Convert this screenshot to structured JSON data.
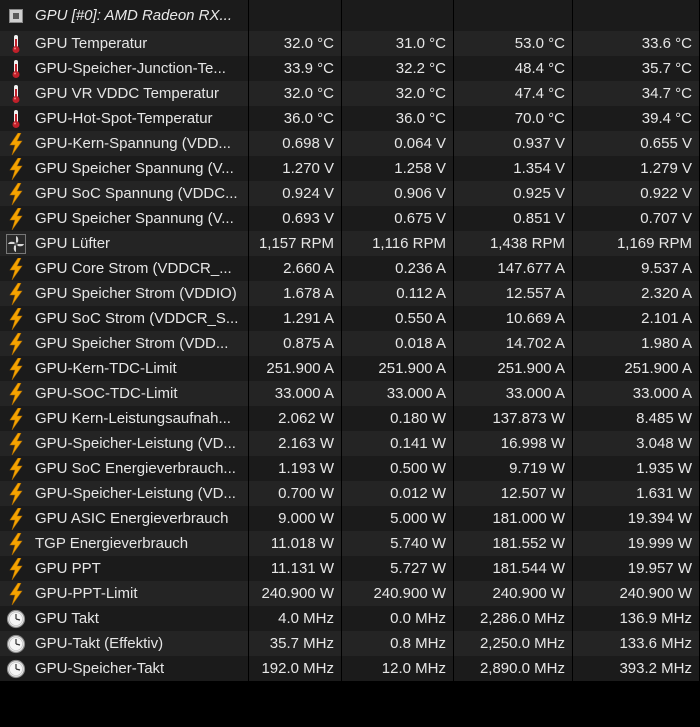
{
  "device": {
    "title": "GPU [#0]: AMD Radeon RX...",
    "icon": "chip-icon"
  },
  "rows": [
    {
      "label": "GPU Temperatur",
      "icon": "thermometer-icon",
      "v": [
        "32.0 °C",
        "31.0 °C",
        "53.0 °C",
        "33.6 °C"
      ]
    },
    {
      "label": "GPU-Speicher-Junction-Te...",
      "icon": "thermometer-icon",
      "v": [
        "33.9 °C",
        "32.2 °C",
        "48.4 °C",
        "35.7 °C"
      ]
    },
    {
      "label": "GPU VR VDDC Temperatur",
      "icon": "thermometer-icon",
      "v": [
        "32.0 °C",
        "32.0 °C",
        "47.4 °C",
        "34.7 °C"
      ]
    },
    {
      "label": "GPU-Hot-Spot-Temperatur",
      "icon": "thermometer-icon",
      "v": [
        "36.0 °C",
        "36.0 °C",
        "70.0 °C",
        "39.4 °C"
      ]
    },
    {
      "label": "GPU-Kern-Spannung (VDD...",
      "icon": "lightning-icon",
      "v": [
        "0.698 V",
        "0.064 V",
        "0.937 V",
        "0.655 V"
      ]
    },
    {
      "label": "GPU Speicher Spannung (V...",
      "icon": "lightning-icon",
      "v": [
        "1.270 V",
        "1.258 V",
        "1.354 V",
        "1.279 V"
      ]
    },
    {
      "label": "GPU SoC Spannung (VDDC...",
      "icon": "lightning-icon",
      "v": [
        "0.924 V",
        "0.906 V",
        "0.925 V",
        "0.922 V"
      ]
    },
    {
      "label": "GPU Speicher Spannung (V...",
      "icon": "lightning-icon",
      "v": [
        "0.693 V",
        "0.675 V",
        "0.851 V",
        "0.707 V"
      ]
    },
    {
      "label": "GPU Lüfter",
      "icon": "fan-icon",
      "v": [
        "1,157 RPM",
        "1,116 RPM",
        "1,438 RPM",
        "1,169 RPM"
      ]
    },
    {
      "label": "GPU Core Strom (VDDCR_...",
      "icon": "lightning-icon",
      "v": [
        "2.660 A",
        "0.236 A",
        "147.677 A",
        "9.537 A"
      ]
    },
    {
      "label": "GPU Speicher Strom (VDDIO)",
      "icon": "lightning-icon",
      "v": [
        "1.678 A",
        "0.112 A",
        "12.557 A",
        "2.320 A"
      ]
    },
    {
      "label": "GPU SoC Strom (VDDCR_S...",
      "icon": "lightning-icon",
      "v": [
        "1.291 A",
        "0.550 A",
        "10.669 A",
        "2.101 A"
      ]
    },
    {
      "label": "GPU Speicher Strom (VDD...",
      "icon": "lightning-icon",
      "v": [
        "0.875 A",
        "0.018 A",
        "14.702 A",
        "1.980 A"
      ]
    },
    {
      "label": "GPU-Kern-TDC-Limit",
      "icon": "lightning-icon",
      "v": [
        "251.900 A",
        "251.900 A",
        "251.900 A",
        "251.900 A"
      ]
    },
    {
      "label": "GPU-SOC-TDC-Limit",
      "icon": "lightning-icon",
      "v": [
        "33.000 A",
        "33.000 A",
        "33.000 A",
        "33.000 A"
      ]
    },
    {
      "label": "GPU Kern-Leistungsaufnah...",
      "icon": "lightning-icon",
      "v": [
        "2.062 W",
        "0.180 W",
        "137.873 W",
        "8.485 W"
      ]
    },
    {
      "label": "GPU-Speicher-Leistung (VD...",
      "icon": "lightning-icon",
      "v": [
        "2.163 W",
        "0.141 W",
        "16.998 W",
        "3.048 W"
      ]
    },
    {
      "label": "GPU SoC Energieverbrauch...",
      "icon": "lightning-icon",
      "v": [
        "1.193 W",
        "0.500 W",
        "9.719 W",
        "1.935 W"
      ]
    },
    {
      "label": "GPU-Speicher-Leistung (VD...",
      "icon": "lightning-icon",
      "v": [
        "0.700 W",
        "0.012 W",
        "12.507 W",
        "1.631 W"
      ]
    },
    {
      "label": "GPU ASIC Energieverbrauch",
      "icon": "lightning-icon",
      "v": [
        "9.000 W",
        "5.000 W",
        "181.000 W",
        "19.394 W"
      ]
    },
    {
      "label": "TGP Energieverbrauch",
      "icon": "lightning-icon",
      "v": [
        "11.018 W",
        "5.740 W",
        "181.552 W",
        "19.999 W"
      ]
    },
    {
      "label": "GPU PPT",
      "icon": "lightning-icon",
      "v": [
        "11.131 W",
        "5.727 W",
        "181.544 W",
        "19.957 W"
      ]
    },
    {
      "label": "GPU-PPT-Limit",
      "icon": "lightning-icon",
      "v": [
        "240.900 W",
        "240.900 W",
        "240.900 W",
        "240.900 W"
      ]
    },
    {
      "label": "GPU Takt",
      "icon": "clock-icon",
      "v": [
        "4.0 MHz",
        "0.0 MHz",
        "2,286.0 MHz",
        "136.9 MHz"
      ]
    },
    {
      "label": "GPU-Takt (Effektiv)",
      "icon": "clock-icon",
      "v": [
        "35.7 MHz",
        "0.8 MHz",
        "2,250.0 MHz",
        "133.6 MHz"
      ]
    },
    {
      "label": "GPU-Speicher-Takt",
      "icon": "clock-icon",
      "v": [
        "192.0 MHz",
        "12.0 MHz",
        "2,890.0 MHz",
        "393.2 MHz"
      ]
    }
  ],
  "colors": {
    "background": "#000000",
    "row": "#1b1b1b",
    "row_alt": "#242424",
    "text": "#e6e6e6",
    "thermometer": "#c0202a",
    "lightning": "#f5a300"
  }
}
